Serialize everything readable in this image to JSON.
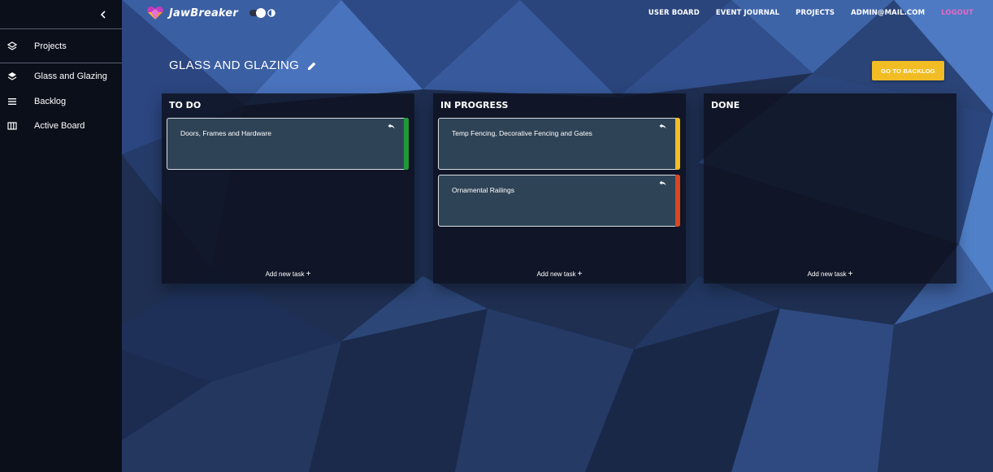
{
  "app": {
    "name": "JawBreaker"
  },
  "colors": {
    "accent": "#f2bd24",
    "logout": "#e46ac8",
    "green": "#1f9a3a",
    "yellow": "#f3bd25",
    "red": "#d9461f"
  },
  "sidebar": {
    "items": [
      {
        "label": "Projects",
        "icon": "layers-icon"
      },
      {
        "label": "Glass and Glazing",
        "icon": "layers-filled-icon"
      },
      {
        "label": "Backlog",
        "icon": "list-icon"
      },
      {
        "label": "Active Board",
        "icon": "board-columns-icon"
      }
    ]
  },
  "nav": {
    "user_board": "USER BOARD",
    "event_journal": "EVENT JOURNAL",
    "projects": "PROJECTS",
    "user": "ADMIN@MAIL.COM",
    "logout": "LOGOUT"
  },
  "page": {
    "title": "GLASS AND GLAZING",
    "backlog_button": "GO TO BACKLOG"
  },
  "columns": [
    {
      "title": "TO DO",
      "add_label": "Add new task",
      "cards": [
        {
          "title": "Doors, Frames and Hardware",
          "priority_color": "#1f9a3a"
        }
      ]
    },
    {
      "title": "IN PROGRESS",
      "add_label": "Add new task",
      "cards": [
        {
          "title": "Temp Fencing, Decorative Fencing and Gates",
          "priority_color": "#f3bd25"
        },
        {
          "title": "Ornamental Railings",
          "priority_color": "#d9461f"
        }
      ]
    },
    {
      "title": "DONE",
      "add_label": "Add new task",
      "cards": []
    }
  ]
}
